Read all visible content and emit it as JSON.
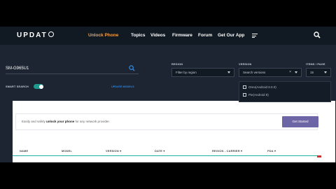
{
  "brand": {
    "logo_prefix": "UPDAT",
    "logo_suffix": "O"
  },
  "nav": {
    "unlock_phone": "Unlock Phone",
    "topics": "Topics",
    "videos": "Videos",
    "firmware": "Firmware",
    "forum": "Forum",
    "get_our_app": "Get Our App"
  },
  "search": {
    "model_value": "SM-G965U1",
    "smart_search_label": "SMART SEARCH",
    "smart_search_on": true,
    "update_models_link": "UPDATE MODELS"
  },
  "filters": {
    "region_label": "REGION",
    "region_placeholder": "Filter by region",
    "version_label": "VERSION",
    "version_placeholder": "Search versions",
    "items_label": "ITEMS / PAGE",
    "items_value": "15",
    "version_options": [
      "Oreo(Android 8.0.0)",
      "Pie(Android 9)"
    ]
  },
  "banner": {
    "text_pre": "Easily and safely ",
    "text_bold": "unlock your phone",
    "text_post": " for any network provider.",
    "button_label": "Get Started"
  },
  "table": {
    "headers": [
      "NAME",
      "MODEL",
      "VERSION ▾",
      "DATE ▾",
      "REGION - CARRIER ▾",
      "PDA ▾"
    ]
  },
  "colors": {
    "accent": "#f0a04b",
    "teal": "#1d9a8d",
    "link": "#2e86de",
    "button": "#6d66a6",
    "nav_bg": "#111923",
    "page_bg": "#1c2531"
  }
}
